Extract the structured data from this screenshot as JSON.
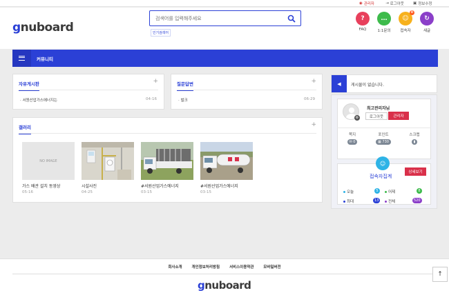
{
  "topbar": {
    "admin": "관리자",
    "logout": "로그아웃",
    "profile": "정보수정"
  },
  "header": {
    "logo": {
      "accent": "g",
      "rest": "nuboard"
    },
    "search_placeholder": "검색어를 입력해주세요",
    "popular_label": "인기검색어",
    "quick": [
      {
        "label": "FAQ",
        "glyph": "?",
        "color": "#e8405c"
      },
      {
        "label": "1:1문의",
        "glyph": "…",
        "color": "#3dbb4b"
      },
      {
        "label": "접속자",
        "glyph": "☺",
        "color": "#f7b11c",
        "badge": "0"
      },
      {
        "label": "새글",
        "glyph": "↻",
        "color": "#8b3fc9"
      }
    ]
  },
  "nav": {
    "label": "커뮤니티"
  },
  "free_board": {
    "title": "자유게시판",
    "post": "서원산업가스에너지는",
    "date": "04-16"
  },
  "qa_board": {
    "title": "질문답변",
    "post": "벌크",
    "date": "06-29"
  },
  "gallery": {
    "title": "갤러리",
    "no_image": "NO IMAGE",
    "items": [
      {
        "title": "가스 배관 설치 동영상",
        "date": "05-16"
      },
      {
        "title": "시설사진",
        "date": "04-25"
      },
      {
        "title": "#서원산업가스에너지",
        "date": "03-15"
      },
      {
        "title": "#서원산업가스에너지",
        "date": "03-15"
      }
    ]
  },
  "notice": {
    "text": "게시물이 없습니다."
  },
  "profile": {
    "nickname": "최고관리자님",
    "logout": "로그아웃",
    "admin": "관리자",
    "stats": [
      {
        "label": "쪽지",
        "value": "0"
      },
      {
        "label": "포인트",
        "value": "730"
      },
      {
        "label": "스크랩",
        "value": "0"
      }
    ]
  },
  "visit": {
    "title": "접속자집계",
    "more": "상세보기",
    "rows": [
      {
        "label": "오늘",
        "value": "5",
        "color": "#2eb3e6"
      },
      {
        "label": "어제",
        "value": "8",
        "color": "#3dbb4b"
      },
      {
        "label": "최대",
        "value": "13",
        "color": "#2b40d6"
      },
      {
        "label": "전체",
        "value": "520",
        "color": "#8b3fc9"
      }
    ]
  },
  "footer": {
    "links": [
      "회사소개",
      "개인정보처리방침",
      "서비스이용약관",
      "모바일버전"
    ],
    "logo": {
      "accent": "g",
      "rest": "nuboard"
    }
  },
  "colors": {
    "primary": "#2b40d6",
    "danger": "#d9304a"
  }
}
